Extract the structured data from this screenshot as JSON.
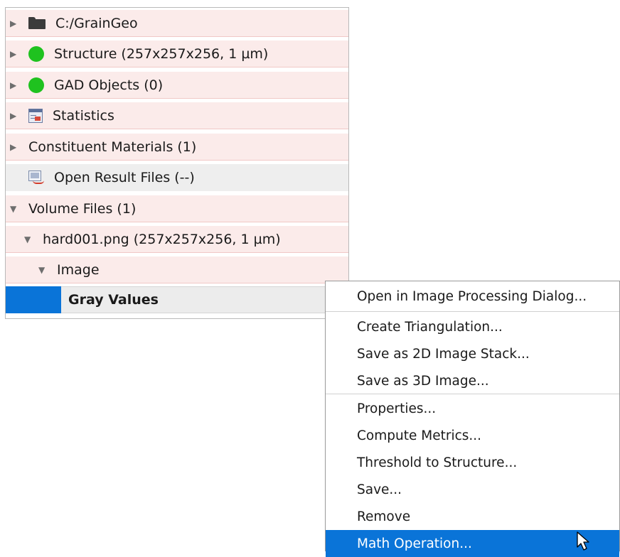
{
  "tree": {
    "items": [
      {
        "label": "C:/GrainGeo",
        "icon": "folder-icon",
        "expand": "collapsed"
      },
      {
        "label": "Structure (257x257x256, 1 µm)",
        "icon": "green-status-dot-icon",
        "expand": "collapsed"
      },
      {
        "label": "GAD Objects (0)",
        "icon": "green-status-dot-icon",
        "expand": "collapsed"
      },
      {
        "label": "Statistics",
        "icon": "statistics-table-icon",
        "expand": "collapsed"
      },
      {
        "label": "Constituent Materials (1)",
        "icon": "",
        "expand": "collapsed"
      },
      {
        "label": "Open Result Files (--)",
        "icon": "result-files-icon",
        "expand": "none"
      },
      {
        "label": "Volume Files (1)",
        "icon": "",
        "expand": "expanded"
      },
      {
        "label": "hard001.png (257x257x256, 1 µm)",
        "icon": "",
        "expand": "expanded"
      },
      {
        "label": "Image",
        "icon": "",
        "expand": "expanded"
      },
      {
        "label": "Gray Values",
        "icon": "",
        "expand": "none",
        "selected": true
      }
    ]
  },
  "context_menu": {
    "items": [
      "Open in Image Processing Dialog...",
      "Create Triangulation...",
      "Save as 2D Image Stack...",
      "Save as 3D Image...",
      "Properties...",
      "Compute Metrics...",
      "Threshold to Structure...",
      "Save...",
      "Remove",
      "Math Operation..."
    ],
    "highlighted_index": 9
  },
  "colors": {
    "selection_blue": "#0a74d8",
    "row_pink": "#fbebea",
    "status_green": "#1fc21f"
  }
}
